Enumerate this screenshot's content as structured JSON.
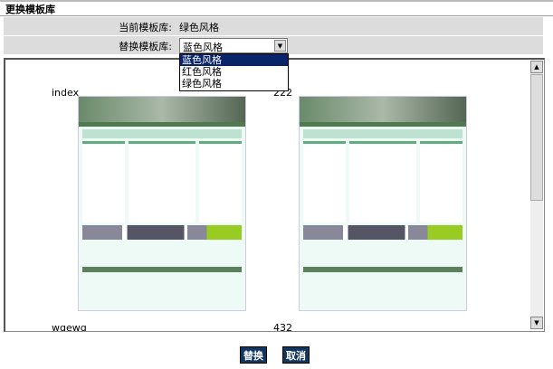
{
  "title": "更换模板库",
  "current": {
    "label": "当前模板库:",
    "value": "绿色风格"
  },
  "replace": {
    "label": "替换模板库:",
    "selected": "蓝色风格",
    "options": [
      "蓝色风格",
      "红色风格",
      "绿色风格"
    ]
  },
  "templates": [
    {
      "name": "index"
    },
    {
      "name": "222"
    },
    {
      "name": "wqewq"
    },
    {
      "name": "432"
    }
  ],
  "buttons": {
    "replace": "替换",
    "cancel": "取消"
  },
  "colors": {
    "button": "#12365e",
    "selected_option": "#0a246a"
  }
}
